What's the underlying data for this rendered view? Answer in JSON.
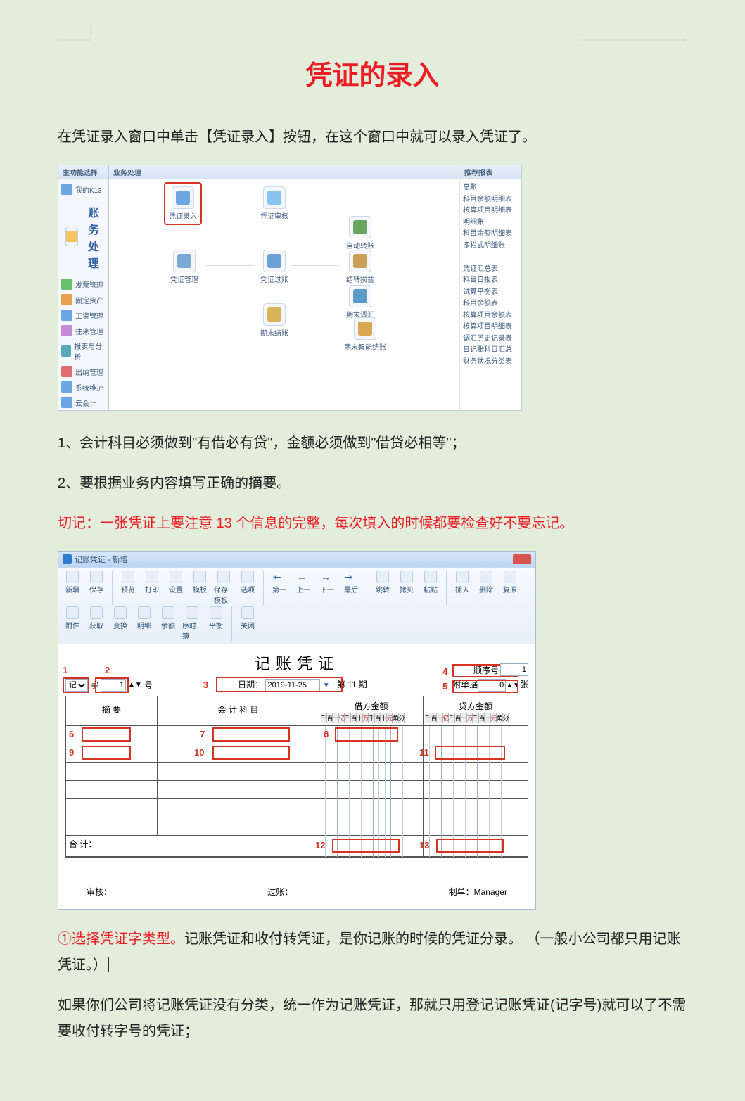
{
  "title": "凭证的录入",
  "intro": "在凭证录入窗口中单击【凭证录入】按钮，在这个窗口中就可以录入凭证了。",
  "rule1": "1、会计科目必须做到\"有借必有贷\"，金额必须做到\"借贷必相等\"；",
  "rule2": "2、要根据业务内容填写正确的摘要。",
  "remind_prefix": "切记：一张凭证上要注意 13 个信息的完整，每次填入的时候都要检查好不要忘记。",
  "shot1": {
    "hdr_left": "主功能选择",
    "hdr_mid": "业务处理",
    "hdr_right": "推荐报表",
    "my": "我的K13",
    "module": "账务处理",
    "menu": [
      "发票管理",
      "固定资产",
      "工资管理",
      "往来管理",
      "报表与分析",
      "出纳管理",
      "系统维护",
      "云会计"
    ],
    "flow": {
      "n1": "凭证录入",
      "n2": "凭证审核",
      "n3": "自动转账",
      "n4": "凭证管理",
      "n5": "凭证过账",
      "n6": "结转损益",
      "n7": "期末结账",
      "n8": "期末调汇",
      "n9": "期末智能结账"
    },
    "reports": [
      "总账",
      "科目余额明细表",
      "核算项目明细表",
      "明细账",
      "科目余额明细表",
      "多栏式明细账",
      "",
      "凭证汇总表",
      "科目日报表",
      "试算平衡表",
      "科目余额表",
      "核算项目余额表",
      "核算项目明细表",
      "调汇历史记录表",
      "日记账科目汇总",
      "财务状况分类表"
    ]
  },
  "shot2": {
    "wintitle": "记账凭证 - 新增",
    "toolbar": [
      "新增",
      "保存",
      "预览",
      "打印",
      "设置",
      "模板",
      "保存模板",
      "选项",
      "第一",
      "上一",
      "下一",
      "最后",
      "跳转",
      "拷贝",
      "粘贴",
      "插入",
      "删除",
      "复原",
      "附件",
      "获取",
      "变换",
      "明细",
      "余额",
      "序时簿",
      "平衡",
      "关闭"
    ],
    "form_title": "记账凭证",
    "type_label": "记",
    "type_suffix1": "字",
    "type_num": "1",
    "type_suffix2": "号",
    "date_label": "日期：",
    "date_value": "2019-11-25",
    "period_pre": "第",
    "period_n": "11",
    "period_suf": "期",
    "seq_label": "顺序号",
    "seq_val": "1",
    "attach_label": "附单据",
    "attach_val": "0",
    "attach_suf": "张",
    "col_summary": "摘 要",
    "col_subject": "会 计 科 目",
    "col_debit": "借方金额",
    "col_credit": "贷方金额",
    "digits": [
      "千",
      "百",
      "十",
      "亿",
      "千",
      "百",
      "十",
      "万",
      "千",
      "百",
      "十",
      "元",
      "角",
      "分"
    ],
    "total": "合 计：",
    "reviewer": "审核：",
    "poster": "过账：",
    "maker_l": "制单：",
    "maker_v": "Manager",
    "n1": "1",
    "n2": "2",
    "n3": "3",
    "n4": "4",
    "n5": "5",
    "n6": "6",
    "n7": "7",
    "n8": "8",
    "n9": "9",
    "n10": "10",
    "n11": "11",
    "n12": "12",
    "n13": "13"
  },
  "p_step1_a": "①选择凭证字类型。",
  "p_step1_b": "记账凭证和收付转凭证，是你记账的时候的凭证分录。 （一般小公司都只用记账凭证。）",
  "p_step1_c": "如果你们公司将记账凭证没有分类，统一作为记账凭证，那就只用登记记账凭证(记字号)就可以了不需要收付转字号的凭证；"
}
